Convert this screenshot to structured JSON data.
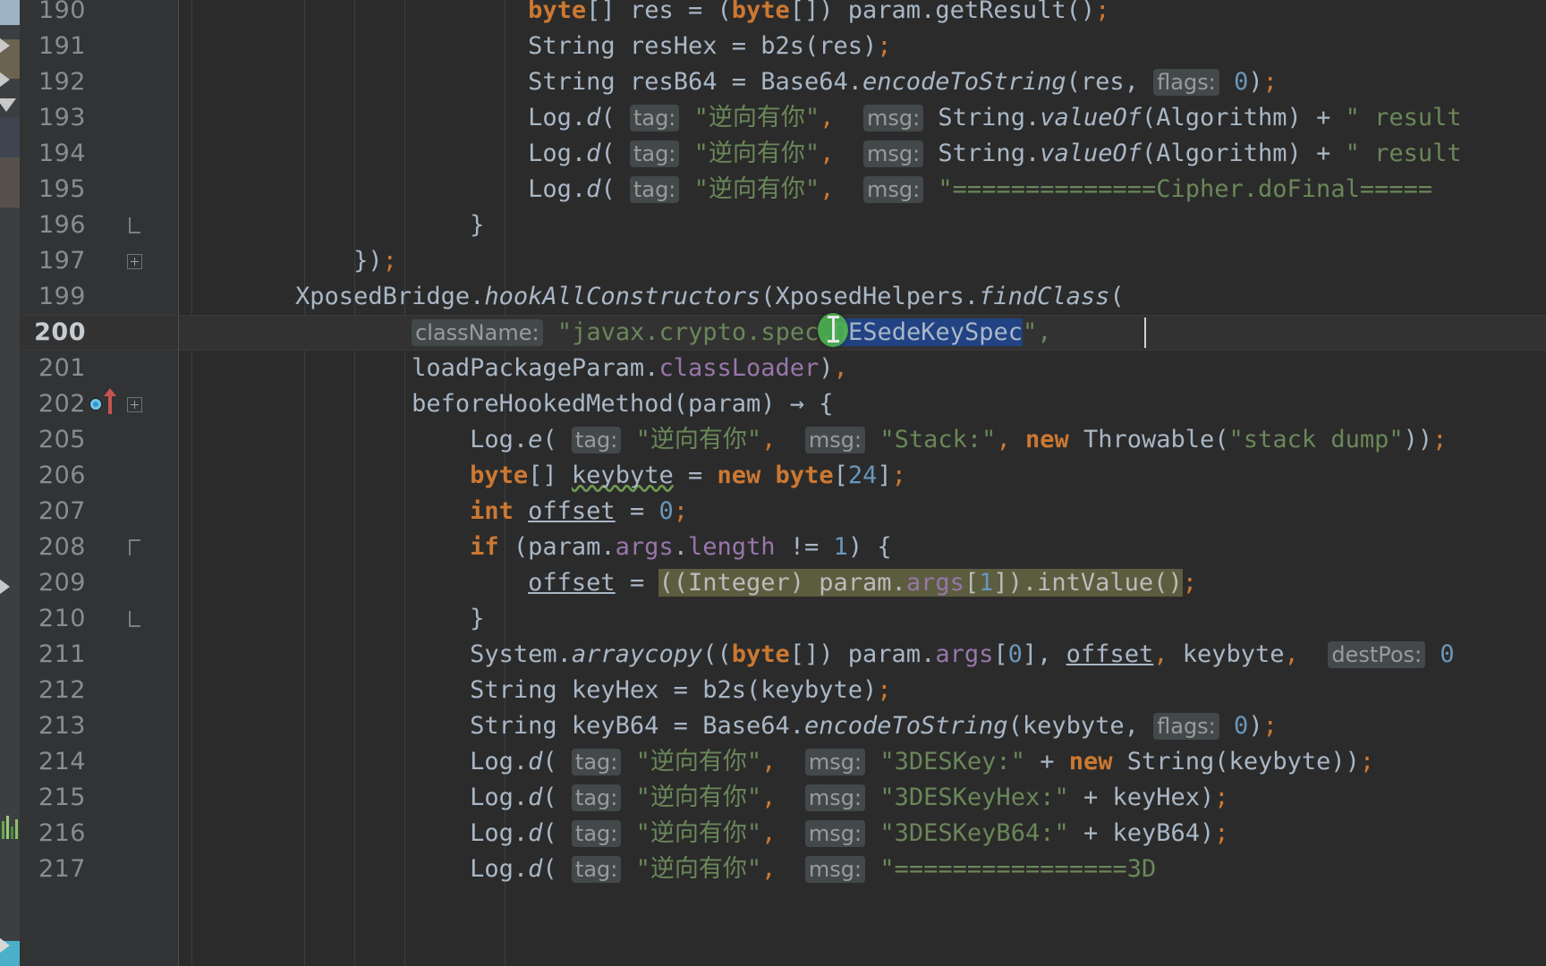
{
  "editor": {
    "theme_bg": "#2b2b2b",
    "gutter_bg": "#313335",
    "selection_color": "#214283",
    "highlight_color": "#5c5c3f",
    "caret_line_color": "#323232",
    "selected_text": "DESedeKeySpec",
    "current_line_number": "200"
  },
  "gutter": {
    "line_numbers": [
      "190",
      "191",
      "192",
      "193",
      "194",
      "195",
      "196",
      "197",
      "199",
      "200",
      "201",
      "202",
      "205",
      "206",
      "207",
      "208",
      "209",
      "210",
      "211",
      "212",
      "213",
      "214",
      "215",
      "216",
      "217"
    ]
  },
  "lines": [
    {
      "num": "190",
      "segments": [
        {
          "t": "                        ",
          "c": "plain"
        },
        {
          "t": "byte",
          "c": "kw"
        },
        {
          "t": "[] res = (",
          "c": "plain"
        },
        {
          "t": "byte",
          "c": "kw"
        },
        {
          "t": "[]) param.",
          "c": "plain"
        },
        {
          "t": "getResult",
          "c": "plain"
        },
        {
          "t": "()",
          "c": "plain"
        },
        {
          "t": ";",
          "c": "punc"
        }
      ]
    },
    {
      "num": "191",
      "segments": [
        {
          "t": "                        ",
          "c": "plain"
        },
        {
          "t": "String resHex = b2s(res)",
          "c": "plain"
        },
        {
          "t": ";",
          "c": "punc"
        }
      ]
    },
    {
      "num": "192",
      "segments": [
        {
          "t": "                        ",
          "c": "plain"
        },
        {
          "t": "String resB64 = Base64.",
          "c": "plain"
        },
        {
          "t": "encodeToString",
          "c": "ital"
        },
        {
          "t": "(res, ",
          "c": "plain"
        },
        {
          "t": "flags:",
          "c": "hint"
        },
        {
          "t": " ",
          "c": "plain"
        },
        {
          "t": "0",
          "c": "num"
        },
        {
          "t": ")",
          "c": "plain"
        },
        {
          "t": ";",
          "c": "punc"
        }
      ]
    },
    {
      "num": "193",
      "segments": [
        {
          "t": "                        ",
          "c": "plain"
        },
        {
          "t": "Log.",
          "c": "plain"
        },
        {
          "t": "d",
          "c": "ital"
        },
        {
          "t": "( ",
          "c": "plain"
        },
        {
          "t": "tag:",
          "c": "hint"
        },
        {
          "t": " ",
          "c": "plain"
        },
        {
          "t": "\"逆向有你\"",
          "c": "str"
        },
        {
          "t": ", ",
          "c": "punc"
        },
        {
          "t": " ",
          "c": "plain"
        },
        {
          "t": "msg:",
          "c": "hint"
        },
        {
          "t": " String.",
          "c": "plain"
        },
        {
          "t": "valueOf",
          "c": "ital"
        },
        {
          "t": "(Algorithm) + ",
          "c": "plain"
        },
        {
          "t": "\" result",
          "c": "str"
        }
      ]
    },
    {
      "num": "194",
      "segments": [
        {
          "t": "                        ",
          "c": "plain"
        },
        {
          "t": "Log.",
          "c": "plain"
        },
        {
          "t": "d",
          "c": "ital"
        },
        {
          "t": "( ",
          "c": "plain"
        },
        {
          "t": "tag:",
          "c": "hint"
        },
        {
          "t": " ",
          "c": "plain"
        },
        {
          "t": "\"逆向有你\"",
          "c": "str"
        },
        {
          "t": ", ",
          "c": "punc"
        },
        {
          "t": " ",
          "c": "plain"
        },
        {
          "t": "msg:",
          "c": "hint"
        },
        {
          "t": " String.",
          "c": "plain"
        },
        {
          "t": "valueOf",
          "c": "ital"
        },
        {
          "t": "(Algorithm) + ",
          "c": "plain"
        },
        {
          "t": "\" result",
          "c": "str"
        }
      ]
    },
    {
      "num": "195",
      "segments": [
        {
          "t": "                        ",
          "c": "plain"
        },
        {
          "t": "Log.",
          "c": "plain"
        },
        {
          "t": "d",
          "c": "ital"
        },
        {
          "t": "( ",
          "c": "plain"
        },
        {
          "t": "tag:",
          "c": "hint"
        },
        {
          "t": " ",
          "c": "plain"
        },
        {
          "t": "\"逆向有你\"",
          "c": "str"
        },
        {
          "t": ", ",
          "c": "punc"
        },
        {
          "t": " ",
          "c": "plain"
        },
        {
          "t": "msg:",
          "c": "hint"
        },
        {
          "t": " ",
          "c": "plain"
        },
        {
          "t": "\"==============Cipher.doFinal=====",
          "c": "str"
        }
      ]
    },
    {
      "num": "196",
      "segments": [
        {
          "t": "                    }",
          "c": "plain"
        }
      ]
    },
    {
      "num": "197",
      "segments": [
        {
          "t": "            })",
          "c": "plain"
        },
        {
          "t": ";",
          "c": "punc"
        }
      ]
    },
    {
      "num": "199",
      "segments": [
        {
          "t": "        XposedBridge.",
          "c": "plain"
        },
        {
          "t": "hookAllConstructors",
          "c": "ital"
        },
        {
          "t": "(XposedHelpers.",
          "c": "plain"
        },
        {
          "t": "findClass",
          "c": "ital"
        },
        {
          "t": "(",
          "c": "plain"
        }
      ]
    },
    {
      "num": "200",
      "segments": [
        {
          "t": "                ",
          "c": "plain"
        },
        {
          "t": "className:",
          "c": "hint"
        },
        {
          "t": " ",
          "c": "plain"
        },
        {
          "t": "\"javax.crypto.spec.",
          "c": "str"
        },
        {
          "t": "DESedeKeySpec",
          "c": "sel"
        },
        {
          "t": "\",",
          "c": "str"
        }
      ]
    },
    {
      "num": "201",
      "segments": [
        {
          "t": "                loadPackageParam.",
          "c": "plain"
        },
        {
          "t": "classLoader",
          "c": "fld"
        },
        {
          "t": ")",
          "c": "plain"
        },
        {
          "t": ",",
          "c": "punc"
        }
      ]
    },
    {
      "num": "202",
      "segments": [
        {
          "t": "                beforeHookedMethod(param) → {",
          "c": "plain"
        }
      ]
    },
    {
      "num": "205",
      "segments": [
        {
          "t": "                    ",
          "c": "plain"
        },
        {
          "t": "Log.",
          "c": "plain"
        },
        {
          "t": "e",
          "c": "ital"
        },
        {
          "t": "( ",
          "c": "plain"
        },
        {
          "t": "tag:",
          "c": "hint"
        },
        {
          "t": " ",
          "c": "plain"
        },
        {
          "t": "\"逆向有你\"",
          "c": "str"
        },
        {
          "t": ", ",
          "c": "punc"
        },
        {
          "t": " ",
          "c": "plain"
        },
        {
          "t": "msg:",
          "c": "hint"
        },
        {
          "t": " ",
          "c": "plain"
        },
        {
          "t": "\"Stack:\"",
          "c": "str"
        },
        {
          "t": ", ",
          "c": "punc"
        },
        {
          "t": "new",
          "c": "kw"
        },
        {
          "t": " Throwable(",
          "c": "plain"
        },
        {
          "t": "\"stack dump\"",
          "c": "str"
        },
        {
          "t": "))",
          "c": "plain"
        },
        {
          "t": ";",
          "c": "punc"
        }
      ]
    },
    {
      "num": "206",
      "segments": [
        {
          "t": "                    ",
          "c": "plain"
        },
        {
          "t": "byte",
          "c": "kw"
        },
        {
          "t": "[] ",
          "c": "plain"
        },
        {
          "t": "keybyte",
          "c": "wavy"
        },
        {
          "t": " = ",
          "c": "plain"
        },
        {
          "t": "new",
          "c": "kw"
        },
        {
          "t": " ",
          "c": "plain"
        },
        {
          "t": "byte",
          "c": "kw"
        },
        {
          "t": "[",
          "c": "plain"
        },
        {
          "t": "24",
          "c": "num"
        },
        {
          "t": "]",
          "c": "plain"
        },
        {
          "t": ";",
          "c": "punc"
        }
      ]
    },
    {
      "num": "207",
      "segments": [
        {
          "t": "                    ",
          "c": "plain"
        },
        {
          "t": "int",
          "c": "kw"
        },
        {
          "t": " ",
          "c": "plain"
        },
        {
          "t": "offset",
          "c": "uline"
        },
        {
          "t": " = ",
          "c": "plain"
        },
        {
          "t": "0",
          "c": "num"
        },
        {
          "t": ";",
          "c": "punc"
        }
      ]
    },
    {
      "num": "208",
      "segments": [
        {
          "t": "                    ",
          "c": "plain"
        },
        {
          "t": "if",
          "c": "kw"
        },
        {
          "t": " (param.",
          "c": "plain"
        },
        {
          "t": "args",
          "c": "fld"
        },
        {
          "t": ".",
          "c": "plain"
        },
        {
          "t": "length",
          "c": "fld"
        },
        {
          "t": " != ",
          "c": "plain"
        },
        {
          "t": "1",
          "c": "num"
        },
        {
          "t": ") {",
          "c": "plain"
        }
      ]
    },
    {
      "num": "209",
      "segments": [
        {
          "t": "                        ",
          "c": "plain"
        },
        {
          "t": "offset",
          "c": "uline"
        },
        {
          "t": " = ",
          "c": "plain"
        },
        {
          "t": "((Integer) param.",
          "c": "hl-olive"
        },
        {
          "t": "args",
          "c": "fld-olive"
        },
        {
          "t": "[",
          "c": "hl-olive"
        },
        {
          "t": "1",
          "c": "num-olive"
        },
        {
          "t": "]).intValue()",
          "c": "hl-olive"
        },
        {
          "t": ";",
          "c": "punc"
        }
      ]
    },
    {
      "num": "210",
      "segments": [
        {
          "t": "                    }",
          "c": "plain"
        }
      ]
    },
    {
      "num": "211",
      "segments": [
        {
          "t": "                    ",
          "c": "plain"
        },
        {
          "t": "System.",
          "c": "plain"
        },
        {
          "t": "arraycopy",
          "c": "ital"
        },
        {
          "t": "((",
          "c": "plain"
        },
        {
          "t": "byte",
          "c": "kw"
        },
        {
          "t": "[]) param.",
          "c": "plain"
        },
        {
          "t": "args",
          "c": "fld"
        },
        {
          "t": "[",
          "c": "plain"
        },
        {
          "t": "0",
          "c": "num"
        },
        {
          "t": "], ",
          "c": "plain"
        },
        {
          "t": "offset",
          "c": "uline"
        },
        {
          "t": ", ",
          "c": "punc"
        },
        {
          "t": "keybyte",
          "c": "plain"
        },
        {
          "t": ", ",
          "c": "punc"
        },
        {
          "t": " ",
          "c": "plain"
        },
        {
          "t": "destPos:",
          "c": "hint"
        },
        {
          "t": " ",
          "c": "plain"
        },
        {
          "t": "0",
          "c": "num"
        }
      ]
    },
    {
      "num": "212",
      "segments": [
        {
          "t": "                    ",
          "c": "plain"
        },
        {
          "t": "String keyHex = b2s(keybyte)",
          "c": "plain"
        },
        {
          "t": ";",
          "c": "punc"
        }
      ]
    },
    {
      "num": "213",
      "segments": [
        {
          "t": "                    ",
          "c": "plain"
        },
        {
          "t": "String keyB64 = Base64.",
          "c": "plain"
        },
        {
          "t": "encodeToString",
          "c": "ital"
        },
        {
          "t": "(keybyte, ",
          "c": "plain"
        },
        {
          "t": "flags:",
          "c": "hint"
        },
        {
          "t": " ",
          "c": "plain"
        },
        {
          "t": "0",
          "c": "num"
        },
        {
          "t": ")",
          "c": "plain"
        },
        {
          "t": ";",
          "c": "punc"
        }
      ]
    },
    {
      "num": "214",
      "segments": [
        {
          "t": "                    ",
          "c": "plain"
        },
        {
          "t": "Log.",
          "c": "plain"
        },
        {
          "t": "d",
          "c": "ital"
        },
        {
          "t": "( ",
          "c": "plain"
        },
        {
          "t": "tag:",
          "c": "hint"
        },
        {
          "t": " ",
          "c": "plain"
        },
        {
          "t": "\"逆向有你\"",
          "c": "str"
        },
        {
          "t": ", ",
          "c": "punc"
        },
        {
          "t": " ",
          "c": "plain"
        },
        {
          "t": "msg:",
          "c": "hint"
        },
        {
          "t": " ",
          "c": "plain"
        },
        {
          "t": "\"3DESKey:\"",
          "c": "str"
        },
        {
          "t": " + ",
          "c": "plain"
        },
        {
          "t": "new",
          "c": "kw"
        },
        {
          "t": " String(keybyte))",
          "c": "plain"
        },
        {
          "t": ";",
          "c": "punc"
        }
      ]
    },
    {
      "num": "215",
      "segments": [
        {
          "t": "                    ",
          "c": "plain"
        },
        {
          "t": "Log.",
          "c": "plain"
        },
        {
          "t": "d",
          "c": "ital"
        },
        {
          "t": "( ",
          "c": "plain"
        },
        {
          "t": "tag:",
          "c": "hint"
        },
        {
          "t": " ",
          "c": "plain"
        },
        {
          "t": "\"逆向有你\"",
          "c": "str"
        },
        {
          "t": ", ",
          "c": "punc"
        },
        {
          "t": " ",
          "c": "plain"
        },
        {
          "t": "msg:",
          "c": "hint"
        },
        {
          "t": " ",
          "c": "plain"
        },
        {
          "t": "\"3DESKeyHex:\"",
          "c": "str"
        },
        {
          "t": " + keyHex)",
          "c": "plain"
        },
        {
          "t": ";",
          "c": "punc"
        }
      ]
    },
    {
      "num": "216",
      "segments": [
        {
          "t": "                    ",
          "c": "plain"
        },
        {
          "t": "Log.",
          "c": "plain"
        },
        {
          "t": "d",
          "c": "ital"
        },
        {
          "t": "( ",
          "c": "plain"
        },
        {
          "t": "tag:",
          "c": "hint"
        },
        {
          "t": " ",
          "c": "plain"
        },
        {
          "t": "\"逆向有你\"",
          "c": "str"
        },
        {
          "t": ", ",
          "c": "punc"
        },
        {
          "t": " ",
          "c": "plain"
        },
        {
          "t": "msg:",
          "c": "hint"
        },
        {
          "t": " ",
          "c": "plain"
        },
        {
          "t": "\"3DESKeyB64:\"",
          "c": "str"
        },
        {
          "t": " + keyB64)",
          "c": "plain"
        },
        {
          "t": ";",
          "c": "punc"
        }
      ]
    },
    {
      "num": "217",
      "segments": [
        {
          "t": "                    ",
          "c": "plain"
        },
        {
          "t": "Log.",
          "c": "plain"
        },
        {
          "t": "d",
          "c": "ital"
        },
        {
          "t": "( ",
          "c": "plain"
        },
        {
          "t": "tag:",
          "c": "hint"
        },
        {
          "t": " ",
          "c": "plain"
        },
        {
          "t": "\"逆向有你\"",
          "c": "str"
        },
        {
          "t": ", ",
          "c": "punc"
        },
        {
          "t": " ",
          "c": "plain"
        },
        {
          "t": "msg:",
          "c": "hint"
        },
        {
          "t": " ",
          "c": "plain"
        },
        {
          "t": "\"================3D",
          "c": "str"
        }
      ]
    }
  ],
  "markers": {
    "run_marker_line": "202",
    "override_marker_line": "202",
    "fold_plus_lines": [
      "197",
      "202"
    ],
    "fold_brace_lines": [
      "196",
      "208",
      "210"
    ]
  }
}
